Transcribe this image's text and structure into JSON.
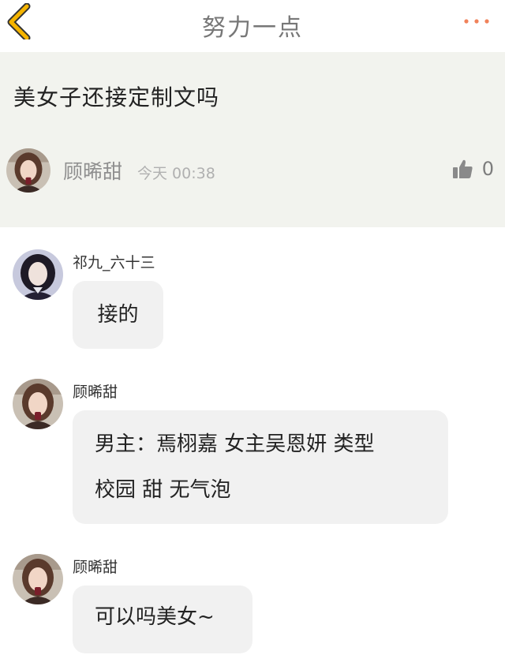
{
  "header": {
    "title": "努力一点",
    "back_icon": "chevron-left-icon",
    "more_icon": "more-dots-icon",
    "accent_color": "#f5b400",
    "more_color": "#f0825a"
  },
  "post": {
    "text": "美女子还接定制文吗",
    "author": "顾晞甜",
    "time": "今天 00:38",
    "like_icon": "thumbs-up-icon",
    "like_count": "0",
    "background": "#f2f3ee"
  },
  "comments": [
    {
      "name": "祁九_六十三",
      "lines": [
        "接的"
      ]
    },
    {
      "name": "顾晞甜",
      "lines": [
        "男主：焉栩嘉 女主吴恩妍 类型",
        "校园 甜 无气泡"
      ]
    },
    {
      "name": "顾晞甜",
      "lines": [
        "可以吗美女~"
      ]
    }
  ]
}
